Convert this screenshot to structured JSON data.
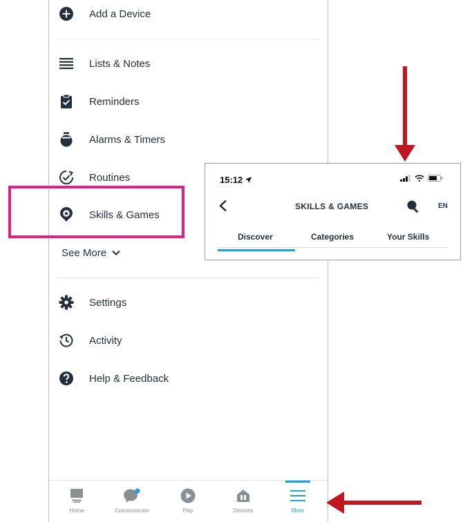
{
  "menu": {
    "add_device": "Add a Device",
    "lists_notes": "Lists & Notes",
    "reminders": "Reminders",
    "alarms_timers": "Alarms & Timers",
    "routines": "Routines",
    "skills_games": "Skills & Games",
    "see_more": "See More",
    "settings": "Settings",
    "activity": "Activity",
    "help_feedback": "Help & Feedback"
  },
  "bottom_nav": {
    "home": "Home",
    "communicate": "Communicate",
    "play": "Play",
    "devices": "Devices",
    "more": "More",
    "active": "More"
  },
  "inset": {
    "time": "15:12",
    "title": "SKILLS & GAMES",
    "lang": "EN",
    "tabs": [
      "Discover",
      "Categories",
      "Your Skills"
    ],
    "active_tab": "Discover"
  },
  "colors": {
    "highlight": "#e0218a",
    "arrow": "#c0161f",
    "accent": "#1aa3d9",
    "text": "#232f3e"
  }
}
